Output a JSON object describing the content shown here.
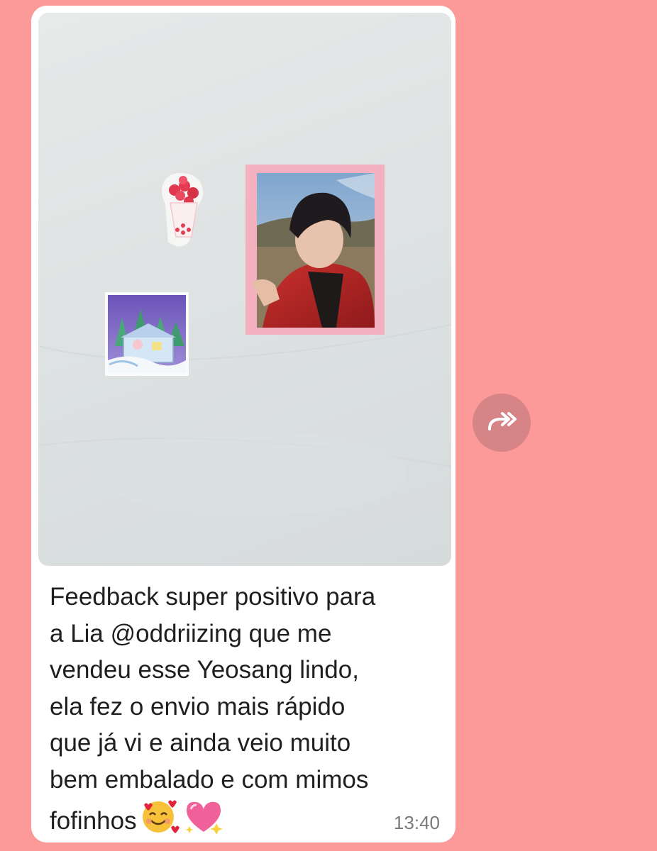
{
  "message": {
    "caption": "Feedback super positivo para\na Lia @oddriizing que me\nvendeu esse Yeosang lindo,\nela fez o envio mais rápido\nque já vi e ainda veio muito\nbem embalado e com mimos\nfofinhos",
    "emojis": [
      "smiling-face-with-hearts",
      "sparkling-heart"
    ],
    "time": "13:40"
  },
  "colors": {
    "background": "#fc9a9a",
    "bubble": "#ffffff",
    "forward_button": "#d68486"
  },
  "icons": {
    "forward": "double-chevron-forward-icon"
  }
}
